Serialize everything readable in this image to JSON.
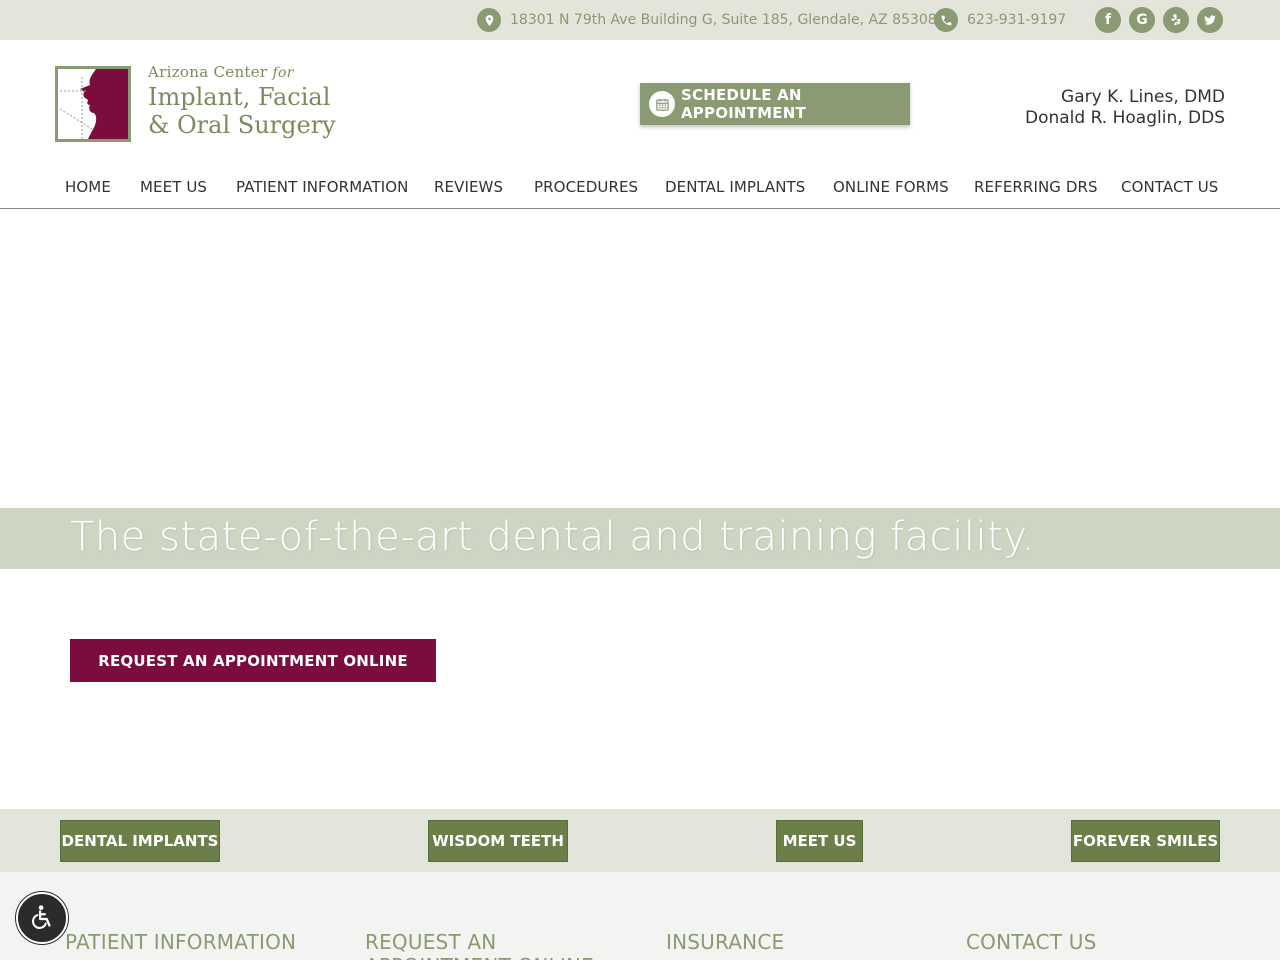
{
  "topbar": {
    "address": "18301 N 79th Ave Building G, Suite 185, Glendale, AZ 85308",
    "phone": "623-931-9197",
    "social": {
      "facebook": "f",
      "google": "G"
    }
  },
  "logo": {
    "line1": "Arizona Center",
    "line1_suffix": "for",
    "line2": "Implant, Facial",
    "line3": "& Oral Surgery"
  },
  "header": {
    "schedule_label": "SCHEDULE AN APPOINTMENT",
    "doctors": [
      "Gary K. Lines, DMD",
      "Donald R. Hoaglin, DDS"
    ]
  },
  "nav": [
    {
      "label": "HOME"
    },
    {
      "label": "MEET US"
    },
    {
      "label": "PATIENT INFORMATION"
    },
    {
      "label": "REVIEWS"
    },
    {
      "label": "PROCEDURES"
    },
    {
      "label": "DENTAL IMPLANTS"
    },
    {
      "label": "ONLINE FORMS"
    },
    {
      "label": "REFERRING DRS"
    },
    {
      "label": "CONTACT US"
    }
  ],
  "hero": {
    "tagline": "The state-of-the-art dental and training facility.",
    "request_label": "REQUEST AN APPOINTMENT ONLINE"
  },
  "quicklinks": [
    {
      "label": "DENTAL IMPLANTS"
    },
    {
      "label": "WISDOM TEETH"
    },
    {
      "label": "MEET US"
    },
    {
      "label": "FOREVER SMILES"
    }
  ],
  "footer": {
    "headings": [
      "PATIENT INFORMATION",
      "REQUEST AN APPOINTMENT ONLINE",
      "INSURANCE",
      "CONTACT US"
    ]
  },
  "colors": {
    "sage": "#8a9a72",
    "olive_button": "#6b7f49",
    "maroon": "#7a0d3d",
    "light_band": "#e3e5da"
  },
  "icons": {
    "address": "map-pin-icon",
    "phone": "phone-icon",
    "schedule": "calendar-icon",
    "accessibility": "wheelchair-icon"
  }
}
